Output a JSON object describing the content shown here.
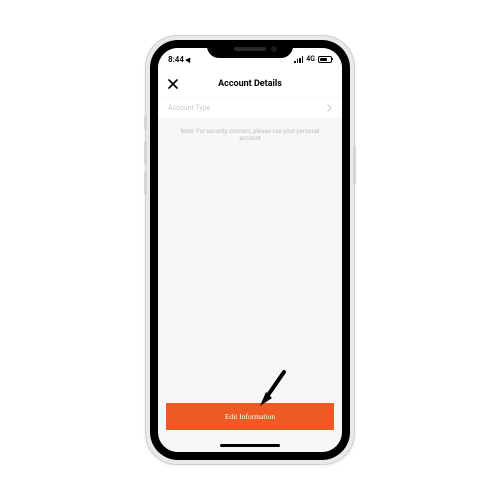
{
  "status": {
    "time": "8:44",
    "network": "4G"
  },
  "nav": {
    "title": "Account Details"
  },
  "row": {
    "label": "Account Type"
  },
  "note": {
    "text": "Note: For security concern, please use your personal account"
  },
  "cta": {
    "label": "Edit Information"
  }
}
